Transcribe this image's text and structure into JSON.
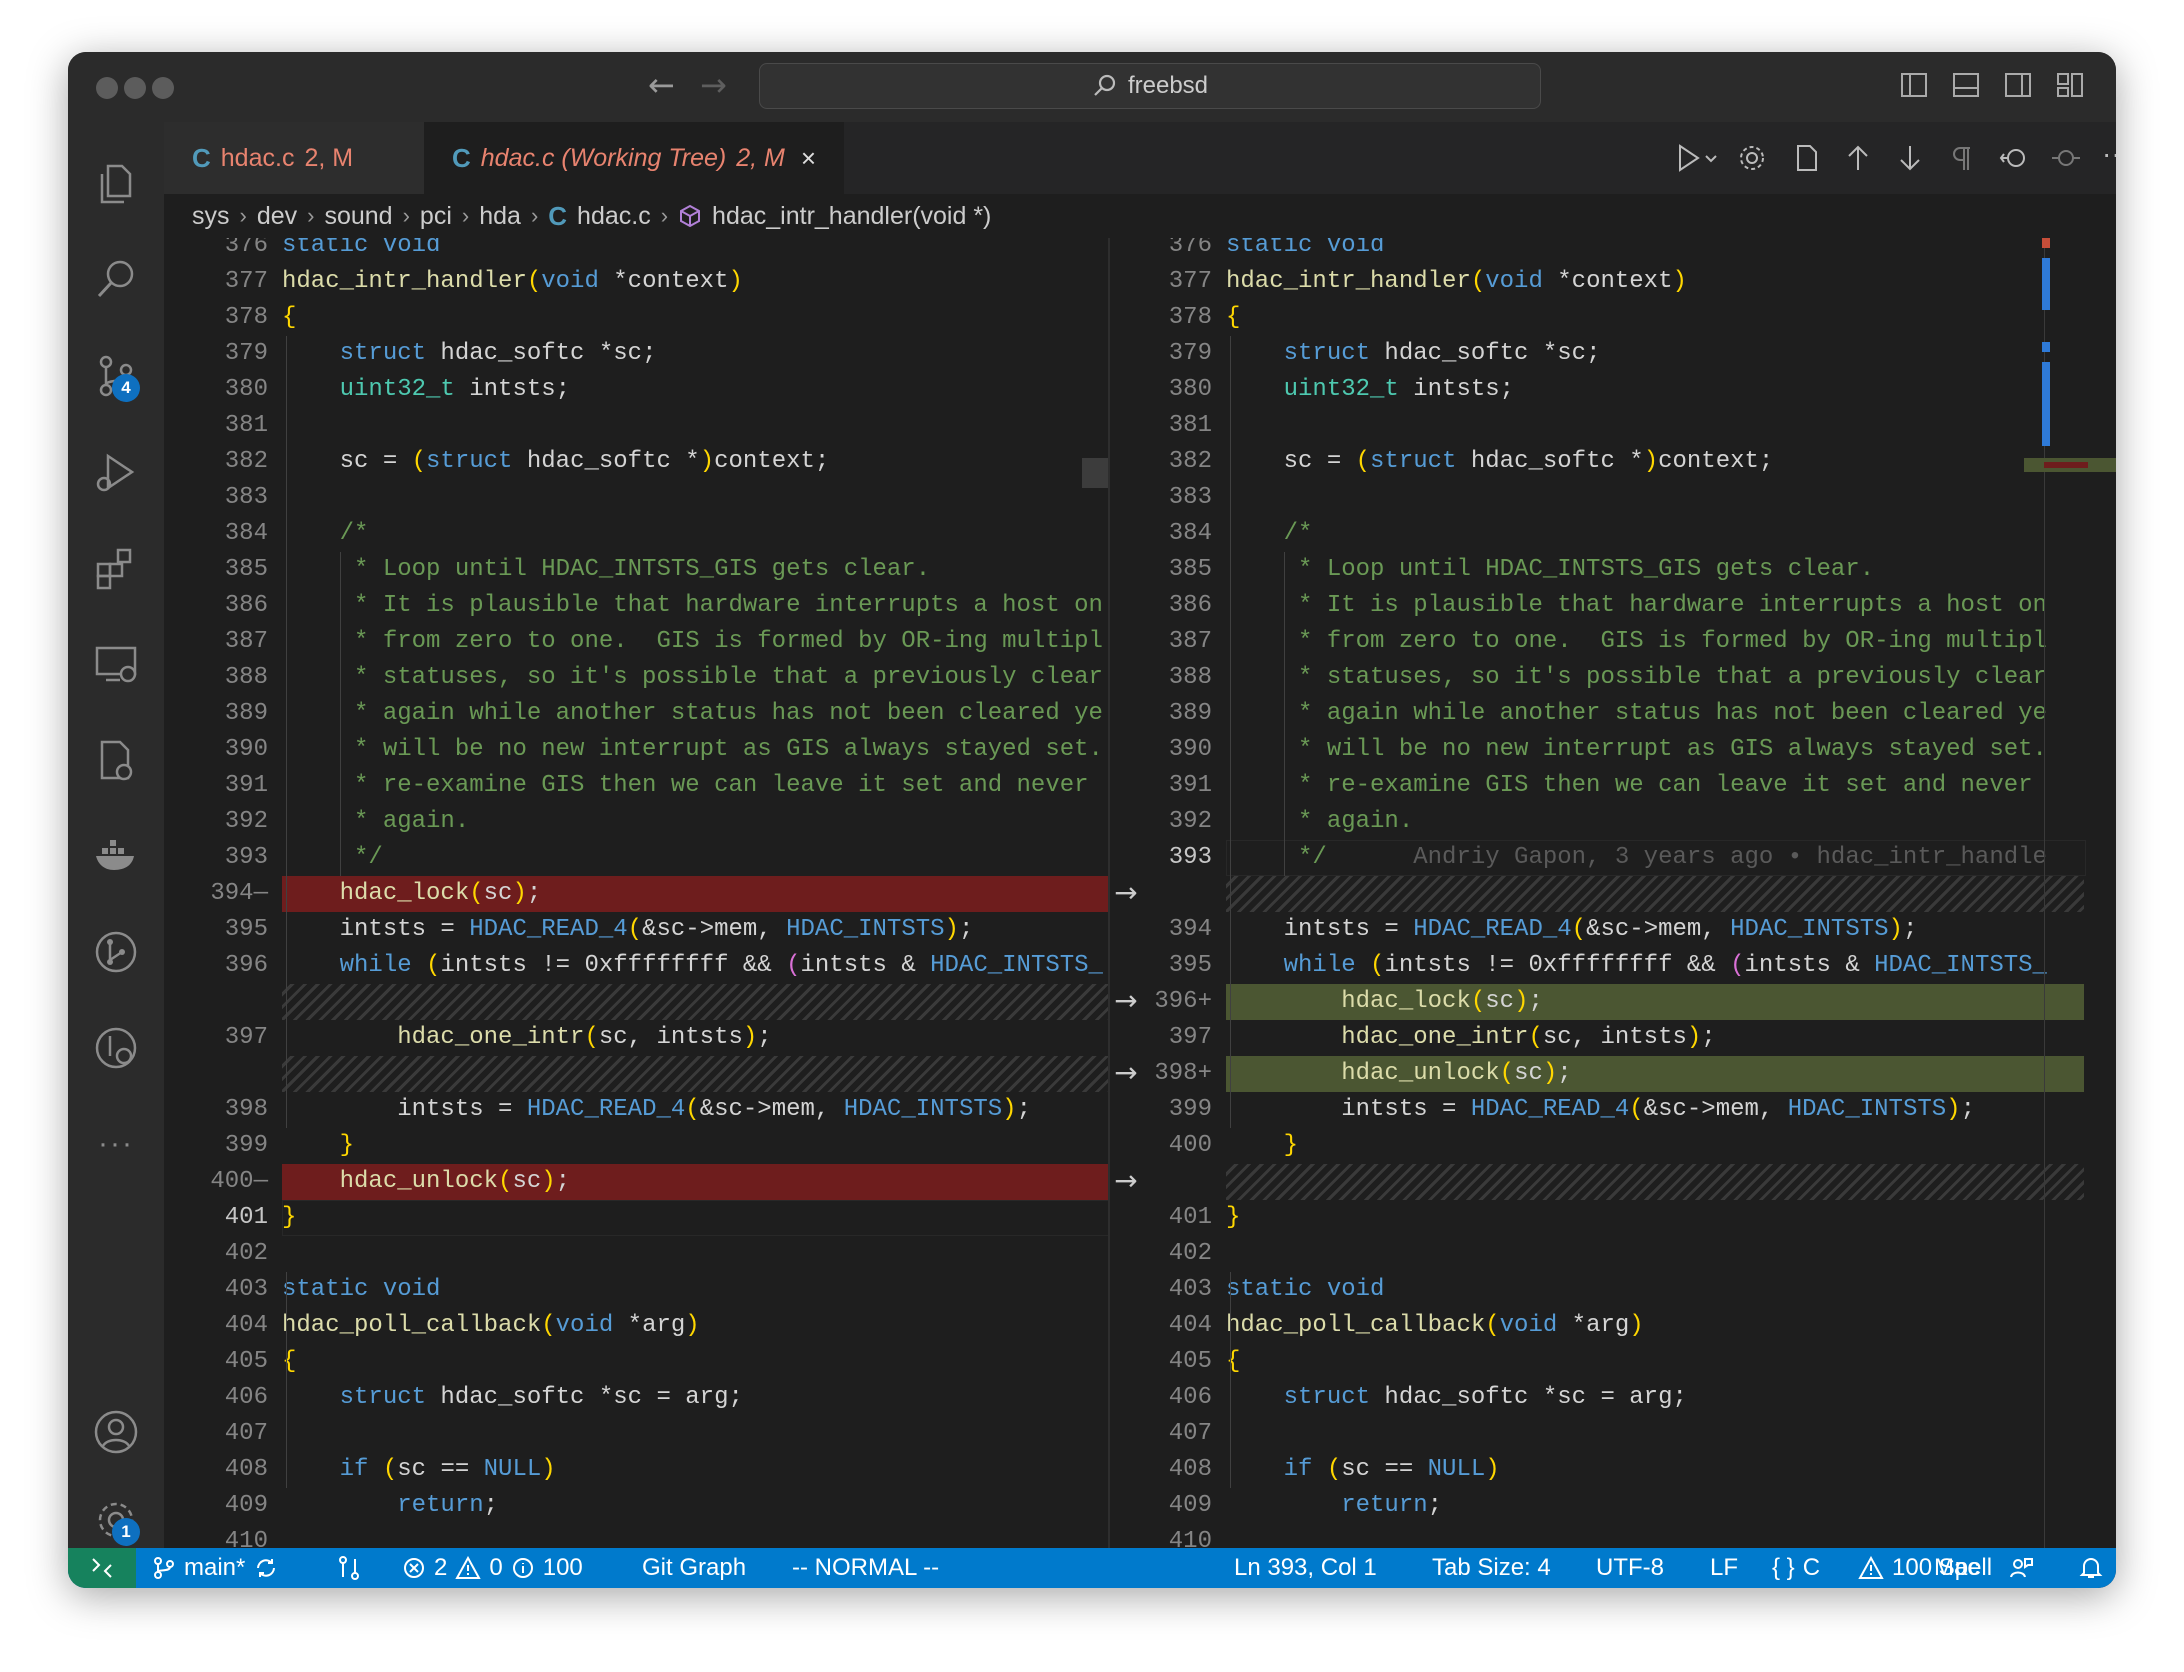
{
  "search": {
    "text": "freebsd"
  },
  "tabs": [
    {
      "icon": "C",
      "name": "hdac.c",
      "status": "2, M"
    },
    {
      "icon": "C",
      "name": "hdac.c (Working Tree)",
      "status": "2, M",
      "close": "×"
    }
  ],
  "breadcrumb": [
    "sys",
    "dev",
    "sound",
    "pci",
    "hda",
    "hdac.c",
    "hdac_intr_handler(void *)"
  ],
  "activity": {
    "scm_badge": "4",
    "settings_badge": "1",
    "more": "···"
  },
  "blame": "Andriy Gapon, 3 years ago • hdac_intr_handle",
  "left_lines": [
    [
      "377",
      "hdac_intr_handler(void *context)"
    ],
    [
      "378",
      "{"
    ],
    [
      "379",
      "    struct hdac_softc *sc;"
    ],
    [
      "380",
      "    uint32_t intsts;"
    ],
    [
      "381",
      ""
    ],
    [
      "382",
      "    sc = (struct hdac_softc *)context;"
    ],
    [
      "383",
      ""
    ],
    [
      "384",
      "    /*"
    ],
    [
      "385",
      "     * Loop until HDAC_INTSTS_GIS gets clear."
    ],
    [
      "386",
      "     * It is plausible that hardware interrupts a host on"
    ],
    [
      "387",
      "     * from zero to one.  GIS is formed by OR-ing multipl"
    ],
    [
      "388",
      "     * statuses, so it's possible that a previously clear"
    ],
    [
      "389",
      "     * again while another status has not been cleared ye"
    ],
    [
      "390",
      "     * will be no new interrupt as GIS always stayed set."
    ],
    [
      "391",
      "     * re-examine GIS then we can leave it set and never"
    ],
    [
      "392",
      "     * again."
    ],
    [
      "393",
      "     */"
    ],
    [
      "394",
      "    hdac_lock(sc);"
    ],
    [
      "395",
      "    intsts = HDAC_READ_4(&sc->mem, HDAC_INTSTS);"
    ],
    [
      "396",
      "    while (intsts != 0xffffffff && (intsts & HDAC_INTSTS_"
    ],
    [
      "397",
      "        hdac_one_intr(sc, intsts);"
    ],
    [
      "398",
      "        intsts = HDAC_READ_4(&sc->mem, HDAC_INTSTS);"
    ],
    [
      "399",
      "    }"
    ],
    [
      "400",
      "    hdac_unlock(sc);"
    ],
    [
      "401",
      "}"
    ],
    [
      "402",
      ""
    ],
    [
      "403",
      "static void"
    ],
    [
      "404",
      "hdac_poll_callback(void *arg)"
    ],
    [
      "405",
      "{"
    ],
    [
      "406",
      "    struct hdac_softc *sc = arg;"
    ],
    [
      "407",
      ""
    ],
    [
      "408",
      "    if (sc == NULL)"
    ],
    [
      "409",
      "        return;"
    ],
    [
      "410",
      ""
    ]
  ],
  "right_lines": [
    [
      "377",
      "hdac_intr_handler(void *context)"
    ],
    [
      "378",
      "{"
    ],
    [
      "379",
      "    struct hdac_softc *sc;"
    ],
    [
      "380",
      "    uint32_t intsts;"
    ],
    [
      "381",
      ""
    ],
    [
      "382",
      "    sc = (struct hdac_softc *)context;"
    ],
    [
      "383",
      ""
    ],
    [
      "384",
      "    /*"
    ],
    [
      "385",
      "     * Loop until HDAC_INTSTS_GIS gets clear."
    ],
    [
      "386",
      "     * It is plausible that hardware interrupts a host on"
    ],
    [
      "387",
      "     * from zero to one.  GIS is formed by OR-ing multipl"
    ],
    [
      "388",
      "     * statuses, so it's possible that a previously clear"
    ],
    [
      "389",
      "     * again while another status has not been cleared ye"
    ],
    [
      "390",
      "     * will be no new interrupt as GIS always stayed set."
    ],
    [
      "391",
      "     * re-examine GIS then we can leave it set and never"
    ],
    [
      "392",
      "     * again."
    ],
    [
      "393",
      "     */"
    ],
    [
      "394",
      "    intsts = HDAC_READ_4(&sc->mem, HDAC_INTSTS);"
    ],
    [
      "395",
      "    while (intsts != 0xffffffff && (intsts & HDAC_INTSTS_"
    ],
    [
      "396",
      "        hdac_lock(sc);"
    ],
    [
      "397",
      "        hdac_one_intr(sc, intsts);"
    ],
    [
      "398",
      "        hdac_unlock(sc);"
    ],
    [
      "399",
      "        intsts = HDAC_READ_4(&sc->mem, HDAC_INTSTS);"
    ],
    [
      "400",
      "    }"
    ],
    [
      "401",
      "}"
    ],
    [
      "402",
      ""
    ],
    [
      "403",
      "static void"
    ],
    [
      "404",
      "hdac_poll_callback(void *arg)"
    ],
    [
      "405",
      "{"
    ],
    [
      "406",
      "    struct hdac_softc *sc = arg;"
    ],
    [
      "407",
      ""
    ],
    [
      "408",
      "    if (sc == NULL)"
    ],
    [
      "409",
      "        return;"
    ],
    [
      "410",
      ""
    ]
  ],
  "top_partial": {
    "num": "376",
    "text": "static void"
  },
  "statusbar": {
    "branch": "main*",
    "errors": "2",
    "warnings": "0",
    "info": "100",
    "git_graph": "Git Graph",
    "mode": "-- NORMAL --",
    "position": "Ln 393, Col 1",
    "tab_size": "Tab Size: 4",
    "encoding": "UTF-8",
    "eol": "LF",
    "language": "C",
    "spell": "100 Spell",
    "platform": "Mac"
  },
  "colors": {
    "accent": "#007acc",
    "deleted": "#6e1d1d",
    "added": "#4b5632",
    "remote": "#16825d"
  }
}
